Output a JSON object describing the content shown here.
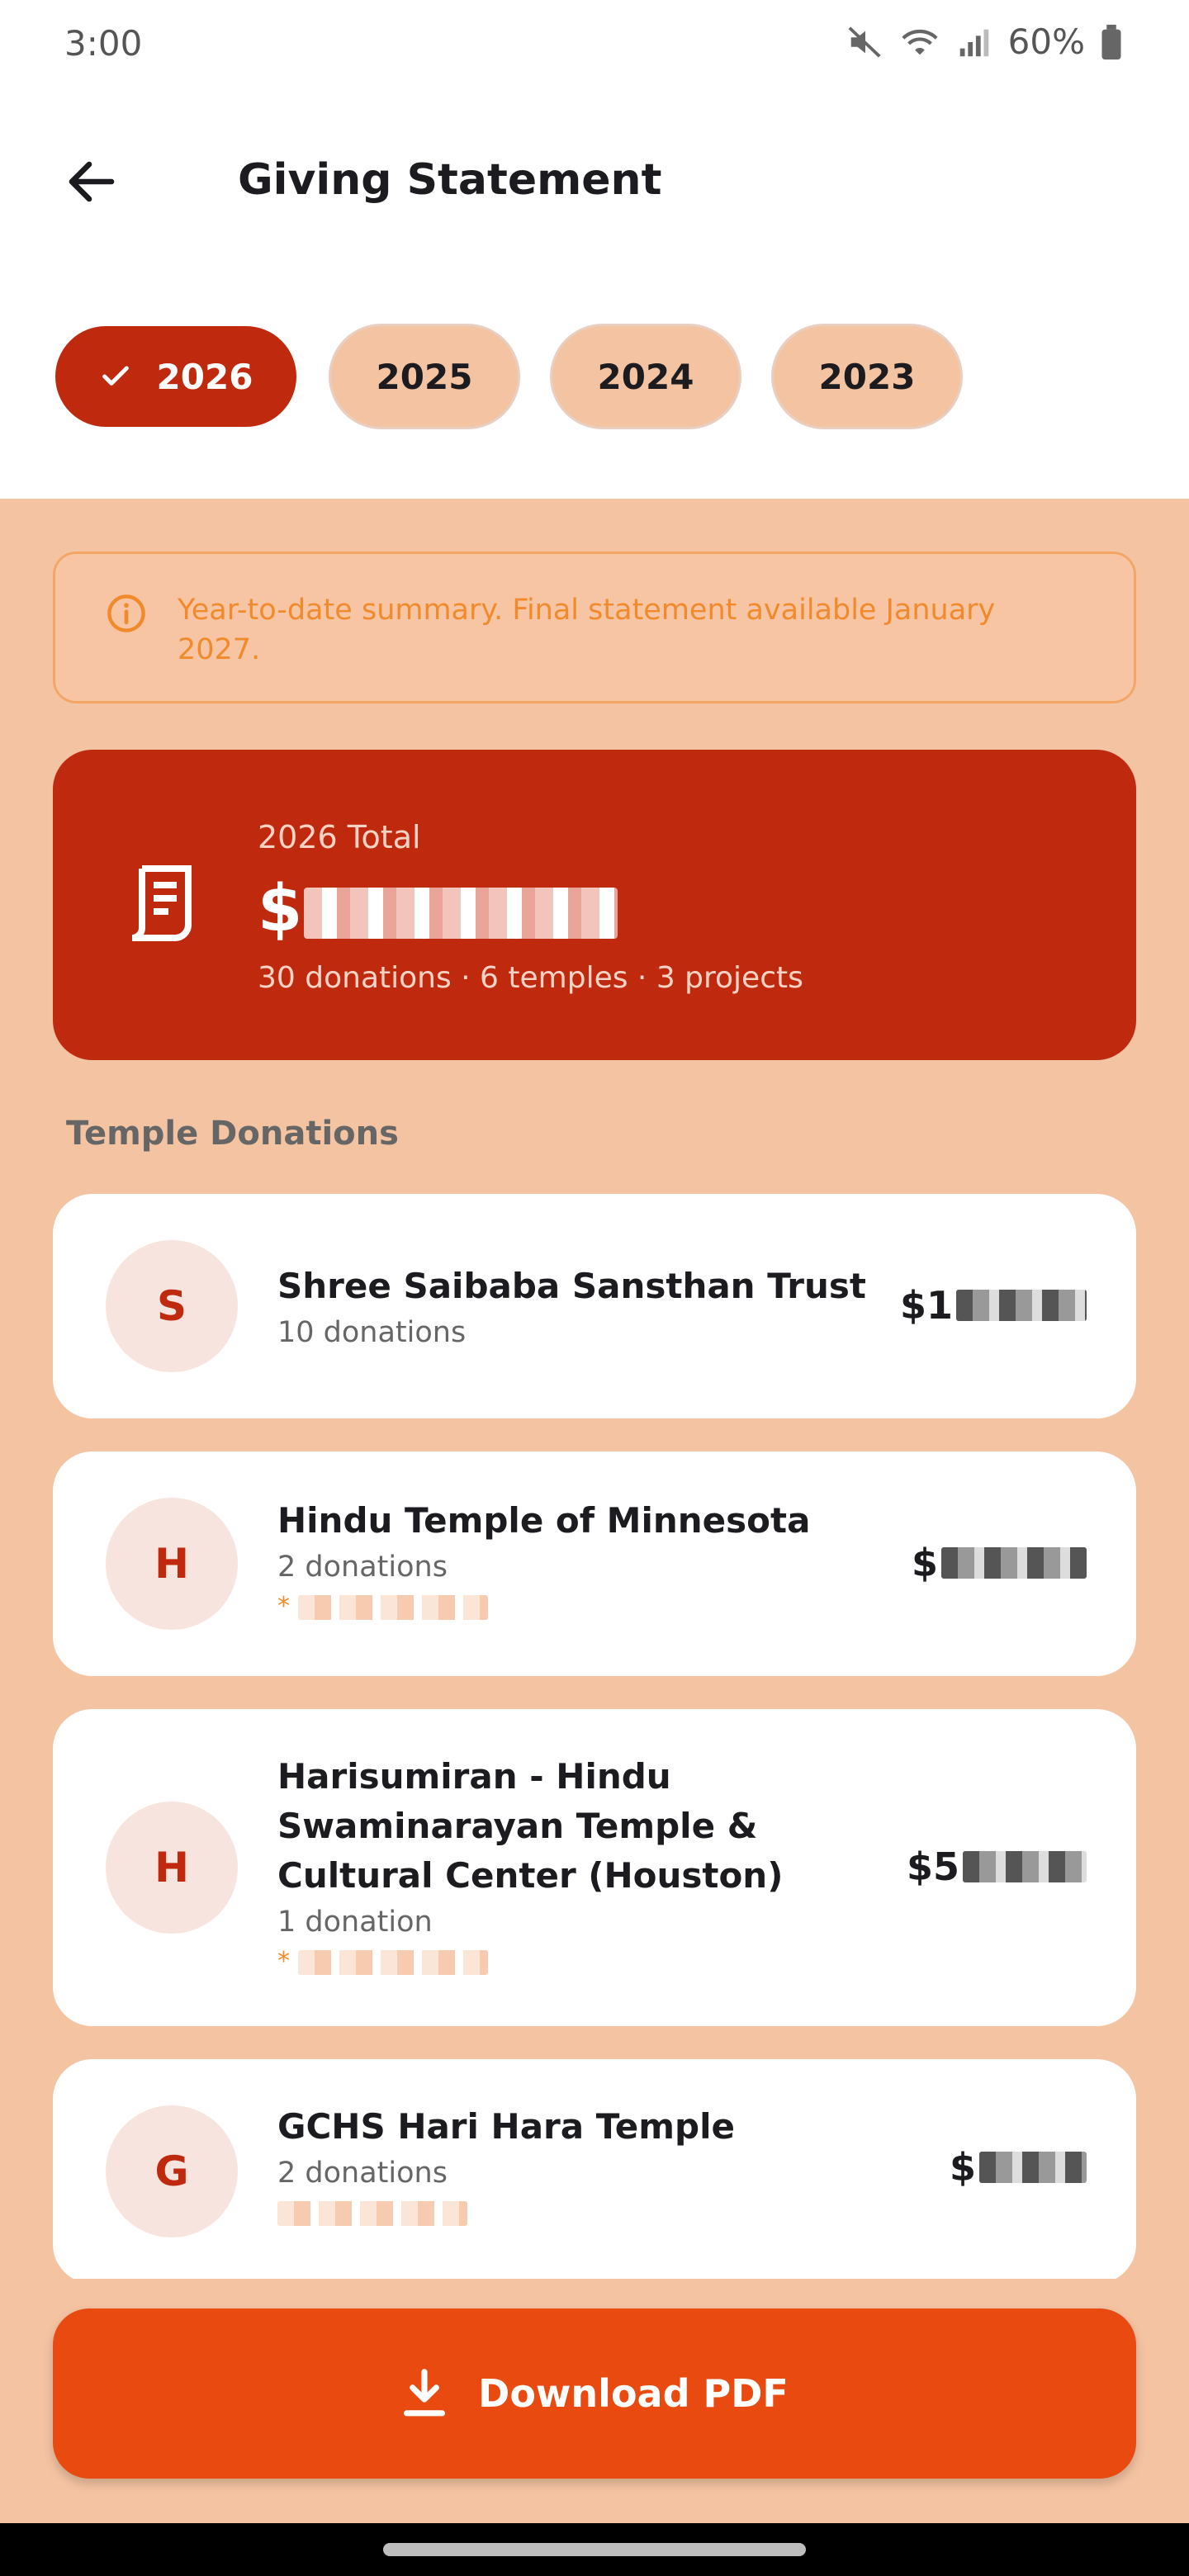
{
  "status_bar": {
    "time": "3:00",
    "battery_percent": "60%"
  },
  "header": {
    "title": "Giving Statement",
    "back_icon": "arrow-back-icon"
  },
  "year_chips": [
    {
      "label": "2026",
      "selected": true
    },
    {
      "label": "2025",
      "selected": false
    },
    {
      "label": "2024",
      "selected": false
    },
    {
      "label": "2023",
      "selected": false
    }
  ],
  "info_banner": {
    "text": "Year-to-date summary. Final statement available January 2027."
  },
  "total_card": {
    "label": "2026 Total",
    "amount_prefix": "$",
    "amount_suffix": "",
    "summary": "30 donations · 6 temples · 3 projects"
  },
  "section": {
    "title": "Temple Donations"
  },
  "temples": [
    {
      "initial": "S",
      "name": "Shree Saibaba Sansthan Trust",
      "count": "10 donations",
      "note_prefix": "",
      "amount_prefix": "$1"
    },
    {
      "initial": "H",
      "name": "Hindu Temple of Minnesota",
      "count": "2 donations",
      "note_prefix": "*",
      "amount_prefix": "$"
    },
    {
      "initial": "H",
      "name": "Harisumiran - Hindu Swaminarayan Temple & Cultural Center (Houston)",
      "count": "1 donation",
      "note_prefix": "*",
      "amount_prefix": "$5"
    },
    {
      "initial": "G",
      "name": "GCHS Hari Hara Temple",
      "count": "2 donations",
      "note_prefix": "",
      "amount_prefix": "$"
    }
  ],
  "download": {
    "label": "Download PDF"
  },
  "colors": {
    "primary": "#bf2a0f",
    "accent": "#e84a10",
    "background": "#f4c3a2",
    "info": "#f08a2b"
  }
}
